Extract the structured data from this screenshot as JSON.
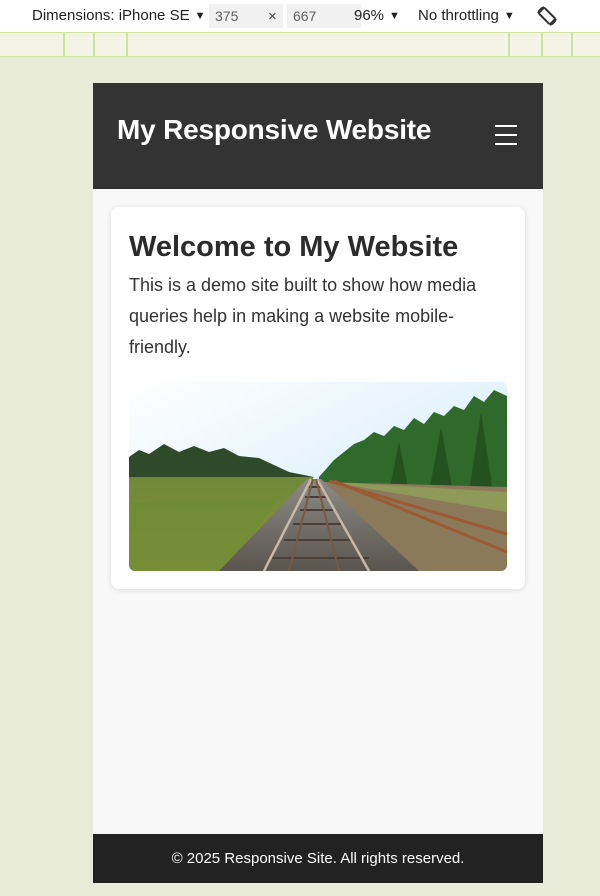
{
  "devtools": {
    "dimensions_label": "Dimensions: iPhone SE",
    "width": "375",
    "times": "×",
    "height": "667",
    "zoom": "96%",
    "throttling": "No throttling",
    "icons": [
      "caret-down-icon",
      "rotate-icon"
    ]
  },
  "site": {
    "title": "My Responsive Website",
    "menu_icon": "hamburger-icon",
    "card": {
      "heading": "Welcome to My Website",
      "text": "This is a demo site built to show how media queries help in making a website mobile-friendly.",
      "image_description": "railway-tracks-landscape"
    },
    "footer": "© 2025 Responsive Site. All rights reserved."
  },
  "colors": {
    "header_bg": "#333333",
    "footer_bg": "#222222",
    "page_bg": "#e9ebd9",
    "content_bg": "#f8f8f8"
  }
}
